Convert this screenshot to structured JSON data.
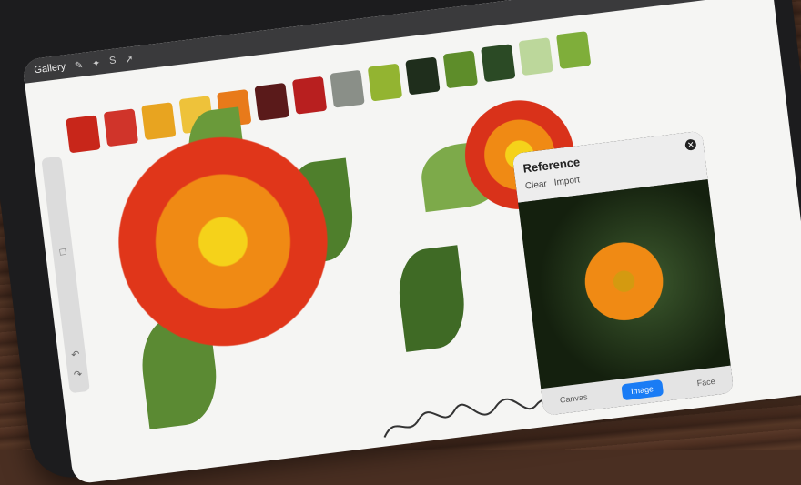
{
  "app": {
    "gallery_label": "Gallery"
  },
  "reference_panel": {
    "title": "Reference",
    "actions": {
      "clear": "Clear",
      "import": "Import"
    },
    "tabs": {
      "canvas": "Canvas",
      "image": "Image",
      "face": "Face"
    },
    "active_tab": "Image"
  },
  "palette": [
    "#c8261a",
    "#d0342a",
    "#e8a420",
    "#eec23a",
    "#e87a1a",
    "#5a1a1a",
    "#b81f1f",
    "#8a8f88",
    "#93b431",
    "#1f2e1c",
    "#5e8d2a",
    "#2b4a25",
    "#bcd79b",
    "#7fae3a"
  ],
  "colors": {
    "active_tab": "#1a7cf5",
    "toolbar": "#3a3a3c",
    "canvas": "#f5f5f3"
  }
}
